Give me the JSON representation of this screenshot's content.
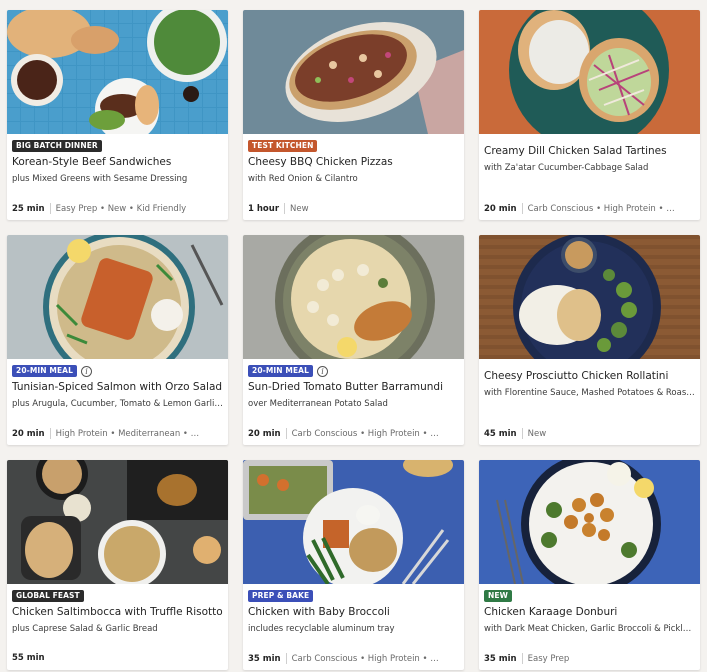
{
  "cards": [
    {
      "badge": "BIG BATCH DINNER",
      "badge_color": "#2b2b2b",
      "info": false,
      "title": "Korean-Style Beef Sandwiches",
      "subtitle": "plus Mixed Greens with Sesame Dressing",
      "time": "25 min",
      "tags": "Easy Prep • New • Kid Friendly",
      "image": "beef-sandwiches-photo"
    },
    {
      "badge": "TEST KITCHEN",
      "badge_color": "#c4572d",
      "info": false,
      "title": "Cheesy BBQ Chicken Pizzas",
      "subtitle": "with Red Onion & Cilantro",
      "time": "1 hour",
      "tags": "New",
      "image": "bbq-pizza-photo"
    },
    {
      "badge": "",
      "badge_color": "",
      "info": false,
      "title": "Creamy Dill Chicken Salad Tartines",
      "subtitle": "with Za'atar Cucumber-Cabbage Salad",
      "time": "20 min",
      "tags": "Carb Conscious • High Protein • …",
      "image": "chicken-tartines-photo"
    },
    {
      "badge": "20-MIN MEAL",
      "badge_color": "#3b4fb8",
      "info": true,
      "title": "Tunisian-Spiced Salmon with Orzo Salad",
      "subtitle": "plus Arugula, Cucumber, Tomato & Lemon Garlic Yo…",
      "time": "20 min",
      "tags": "High Protein • Mediterranean • …",
      "image": "salmon-orzo-photo"
    },
    {
      "badge": "20-MIN MEAL",
      "badge_color": "#3b4fb8",
      "info": true,
      "title": "Sun-Dried Tomato Butter Barramundi",
      "subtitle": "over Mediterranean Potato Salad",
      "time": "20 min",
      "tags": "Carb Conscious • High Protein • …",
      "image": "barramundi-photo"
    },
    {
      "badge": "",
      "badge_color": "",
      "info": false,
      "title": "Cheesy Prosciutto Chicken Rollatini",
      "subtitle": "with Florentine Sauce, Mashed Potatoes & Roasted …",
      "time": "45 min",
      "tags": "New",
      "image": "chicken-rollatini-photo"
    },
    {
      "badge": "GLOBAL FEAST",
      "badge_color": "#2b2b2b",
      "info": false,
      "title": "Chicken Saltimbocca with Truffle Risotto",
      "subtitle": "plus Caprese Salad & Garlic Bread",
      "time": "55 min",
      "tags": "",
      "image": "saltimbocca-photo"
    },
    {
      "badge": "PREP & BAKE",
      "badge_color": "#3b4fb8",
      "info": false,
      "title": "Chicken with Baby Broccoli",
      "subtitle": "includes recyclable aluminum tray",
      "time": "35 min",
      "tags": "Carb Conscious • High Protein • …",
      "image": "chicken-broccoli-photo"
    },
    {
      "badge": "NEW",
      "badge_color": "#2f7a45",
      "info": false,
      "title": "Chicken Karaage Donburi",
      "subtitle": "with Dark Meat Chicken, Garlic Broccoli & Pickled C…",
      "time": "35 min",
      "tags": "Easy Prep",
      "image": "karaage-donburi-photo"
    }
  ]
}
